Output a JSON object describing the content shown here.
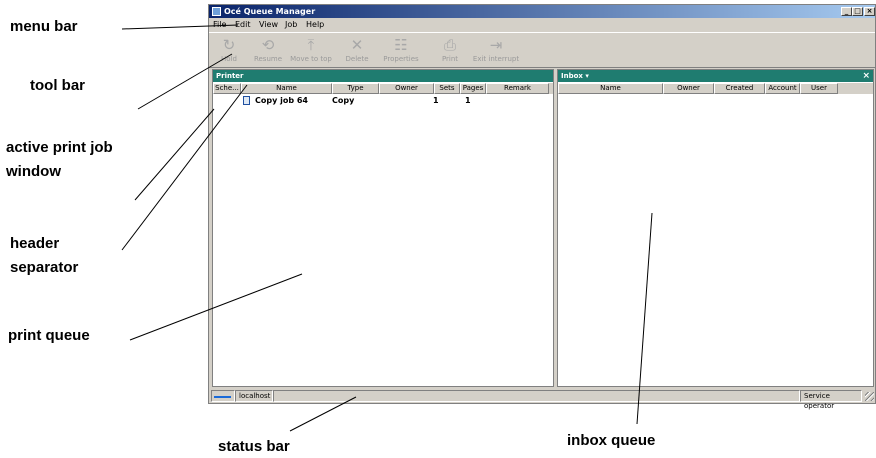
{
  "callouts": {
    "menu_bar": "menu bar",
    "tool_bar": "tool bar",
    "active_print_job_1": "active print job",
    "active_print_job_2": "window",
    "header_sep_1": "header",
    "header_sep_2": "separator",
    "print_queue": "print queue",
    "status_bar": "status bar",
    "inbox_queue": "inbox queue"
  },
  "window": {
    "title": "Océ Queue Manager",
    "controls": {
      "minimize": "_",
      "maximize": "□",
      "close": "×"
    }
  },
  "menu": [
    "File",
    "Edit",
    "View",
    "Job",
    "Help"
  ],
  "toolbar": [
    {
      "label": "Hold",
      "icon": "hold-icon",
      "glyph": "↻"
    },
    {
      "label": "Resume",
      "icon": "resume-icon",
      "glyph": "⟲"
    },
    {
      "label": "Move to top",
      "icon": "move-to-top-icon",
      "glyph": "⤒"
    },
    {
      "label": "Delete",
      "icon": "delete-icon",
      "glyph": "✕"
    },
    {
      "label": "Properties",
      "icon": "properties-icon",
      "glyph": "☷"
    },
    {
      "label": "Print",
      "icon": "print-icon",
      "glyph": "⎙"
    },
    {
      "label": "Exit interrupt",
      "icon": "exit-interrupt-icon",
      "glyph": "⇥"
    }
  ],
  "printer_panel": {
    "title": "Printer",
    "columns": [
      "Sche...",
      "Name",
      "Type",
      "Owner",
      "Sets",
      "Pages",
      "Remark"
    ],
    "rows": [
      {
        "name": "Copy job 64",
        "type": "Copy",
        "owner": "",
        "sets": "1",
        "pages": "1",
        "remark": ""
      }
    ]
  },
  "inbox_panel": {
    "title": "Inbox ▾",
    "close": "×",
    "columns": [
      "Name",
      "Owner",
      "Created",
      "Account",
      "User"
    ]
  },
  "statusbar": {
    "host": "localhost",
    "role": "Service operator"
  },
  "colors": {
    "panel_header": "#1f7c70",
    "title_gradient_start": "#0a246a",
    "title_gradient_end": "#a6caf0"
  }
}
